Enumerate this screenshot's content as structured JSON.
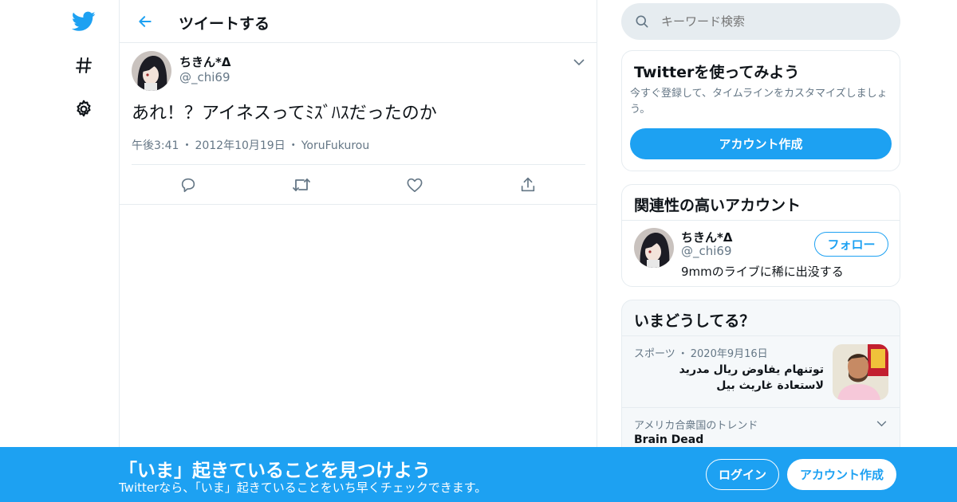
{
  "colors": {
    "accent": "#1da1f2",
    "text_primary": "#0f1419",
    "text_secondary": "#657786",
    "border": "#e6ecf0",
    "panel_gray": "#f5f8fa"
  },
  "left_nav": {
    "items": [
      {
        "icon": "twitter-bird-icon"
      },
      {
        "icon": "hashtag-icon"
      },
      {
        "icon": "gear-icon"
      }
    ]
  },
  "header": {
    "back_icon": "arrow-left-icon",
    "title": "ツイートする"
  },
  "tweet": {
    "author": {
      "display_name": "ちきん*Δ",
      "handle": "@_chi69"
    },
    "text": "あれ！？アイネスってﾐｽﾞﾊｽだったのか",
    "time": "午後3:41",
    "separator": "・",
    "date": "2012年10月19日",
    "source": "YoruFukurou",
    "actions": [
      {
        "icon": "reply-icon"
      },
      {
        "icon": "retweet-icon"
      },
      {
        "icon": "like-heart-icon"
      },
      {
        "icon": "share-icon"
      }
    ]
  },
  "sidebar": {
    "search": {
      "placeholder": "キーワード検索"
    },
    "signup_card": {
      "title": "Twitterを使ってみよう",
      "description": "今すぐ登録して、タイムラインをカスタマイズしましょう。",
      "button": "アカウント作成"
    },
    "related": {
      "title": "関連性の高いアカウント",
      "account": {
        "display_name": "ちきん*Δ",
        "handle": "@_chi69",
        "bio": "9mmのライブに稀に出没する",
        "follow_label": "フォロー"
      }
    },
    "trends": {
      "title": "いまどうしてる？",
      "items": [
        {
          "category": "スポーツ",
          "separator": "・",
          "date": "2020年9月16日",
          "text_line1": "توتنهام يفاوض ريال مدريد",
          "text_line2": "لاستعادة غاريث بيل"
        },
        {
          "category": "アメリカ合衆国のトレンド",
          "text": "Brain Dead"
        }
      ]
    }
  },
  "bottom_bar": {
    "title": "「いま」起きていることを見つけよう",
    "subtitle": "Twitterなら、「いま」起きていることをいち早くチェックできます。",
    "login": "ログイン",
    "signup": "アカウント作成"
  }
}
